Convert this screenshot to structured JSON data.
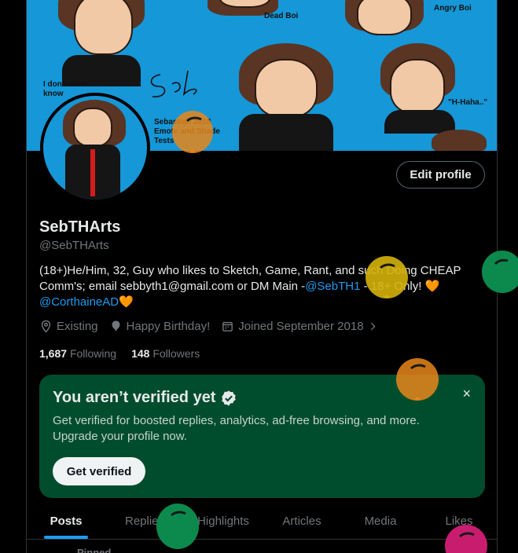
{
  "banner": {
    "captions": [
      "Dead Boi",
      "Angry Boi",
      "I don't even know",
      "\"H-Haha..\"",
      "Sebastian 2018 Emote and Shade Tests"
    ]
  },
  "profile": {
    "edit_label": "Edit profile",
    "name": "SebTHArts",
    "handle": "@SebTHArts",
    "bio_text": "(18+)He/Him, 32, Guy who likes to Sketch, Game, Rant, and such Doing CHEAP Comm's; email sebbyth1@gmail.com or DM Main -",
    "bio_link1": "@SebTH1",
    "bio_mid": " - 18+ Only! ",
    "bio_link2": "@CorthaineAD",
    "heart": "🧡",
    "location": "Existing",
    "birthday": "Happy Birthday!",
    "joined": "Joined September 2018",
    "following_count": "1,687",
    "following_label": "Following",
    "followers_count": "148",
    "followers_label": "Followers"
  },
  "verify": {
    "title": "You aren’t verified yet",
    "description": "Get verified for boosted replies, analytics, ad-free browsing, and more. Upgrade your profile now.",
    "button": "Get verified",
    "close": "×"
  },
  "tabs": [
    "Posts",
    "Replies",
    "Highlights",
    "Articles",
    "Media",
    "Likes"
  ],
  "pinned_label": "Pinned",
  "colors": {
    "accent": "#1d9bf0",
    "verify_bg": "#004d2e",
    "balloon_orange": "#e8861a",
    "balloon_yellow": "#d4b10a",
    "balloon_green": "#0c8a4e",
    "balloon_pink": "#c81c6f"
  }
}
